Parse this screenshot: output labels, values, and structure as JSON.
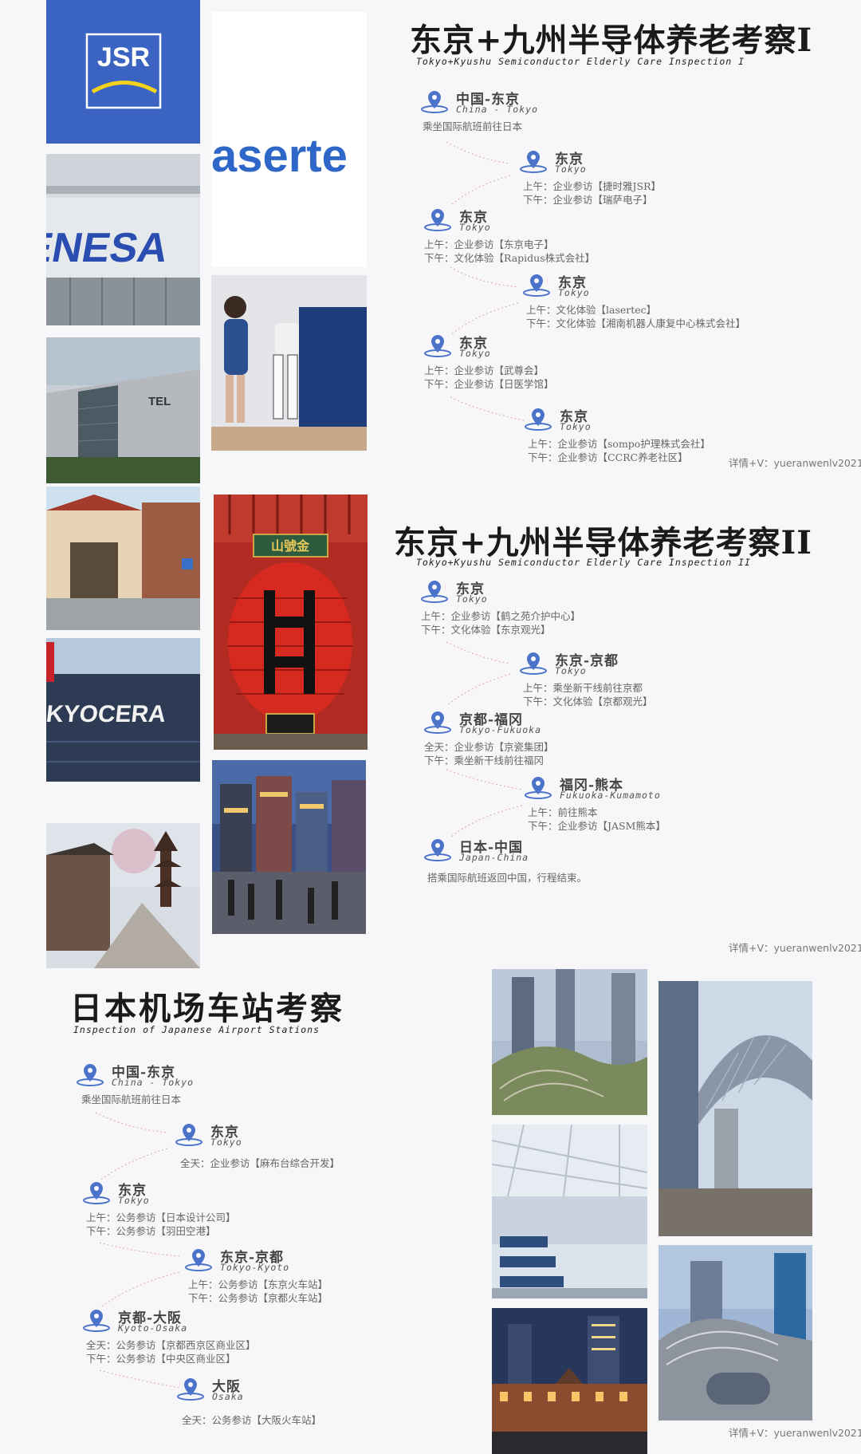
{
  "sections": [
    {
      "title": "东京+九州半导体养老考察I",
      "subtitle": "Tokyo+Kyushu Semiconductor Elderly Care Inspection I",
      "stops": [
        {
          "place": "中国-东京",
          "place_en": "China - Tokyo",
          "lines": [
            "乘坐国际航班前往日本"
          ]
        },
        {
          "place": "东京",
          "place_en": "Tokyo",
          "lines": [
            "上午：企业参访【捷时雅JSR】",
            "下午：企业参访【瑞萨电子】"
          ]
        },
        {
          "place": "东京",
          "place_en": "Tokyo",
          "lines": [
            "上午：企业参访【东京电子】",
            "下午：文化体验【Rapidus株式会社】"
          ]
        },
        {
          "place": "东京",
          "place_en": "Tokyo",
          "lines": [
            "上午：文化体验【lasertec】",
            "下午：文化体验【湘南机器人康复中心株式会社】"
          ]
        },
        {
          "place": "东京",
          "place_en": "Tokyo",
          "lines": [
            "上午：企业参访【武尊会】",
            "下午：企业参访【日医学馆】"
          ]
        },
        {
          "place": "东京",
          "place_en": "Tokyo",
          "lines": [
            "上午：企业参访【sompo护理株式会社】",
            "下午：企业参访【CCRC养老社区】"
          ]
        }
      ],
      "contact": "详情+V：yueranwenlv2021"
    },
    {
      "title": "东京+九州半导体养老考察II",
      "subtitle": "Tokyo+Kyushu Semiconductor Elderly Care Inspection II",
      "stops": [
        {
          "place": "东京",
          "place_en": "Tokyo",
          "lines": [
            "上午：企业参访【鹤之苑介护中心】",
            "下午：文化体验【东京观光】"
          ]
        },
        {
          "place": "东京-京都",
          "place_en": "Tokyo",
          "lines": [
            "上午：乘坐新干线前往京都",
            "下午：文化体验【京都观光】"
          ]
        },
        {
          "place": "京都-福冈",
          "place_en": "Tokyo-Fukuoka",
          "lines": [
            "全天：企业参访【京瓷集团】",
            "下午：乘坐新干线前往福冈"
          ]
        },
        {
          "place": "福冈-熊本",
          "place_en": "Fukuoka-Kumamoto",
          "lines": [
            "上午：前往熊本",
            "下午：企业参访【JASM熊本】"
          ]
        },
        {
          "place": "日本-中国",
          "place_en": "Japan-China",
          "lines": [
            "搭乘国际航班返回中国，行程结束。"
          ]
        }
      ],
      "contact": "详情+V：yueranwenlv2021"
    },
    {
      "title": "日本机场车站考察",
      "subtitle": "Inspection of Japanese Airport Stations",
      "stops": [
        {
          "place": "中国-东京",
          "place_en": "China - Tokyo",
          "lines": [
            "乘坐国际航班前往日本"
          ]
        },
        {
          "place": "东京",
          "place_en": "Tokyo",
          "lines": [
            "全天：企业参访【麻布台综合开发】"
          ]
        },
        {
          "place": "东京",
          "place_en": "Tokyo",
          "lines": [
            "上午：公务参访【日本设计公司】",
            "下午：公务参访【羽田空港】"
          ]
        },
        {
          "place": "东京-京都",
          "place_en": "Tokyo-Kyoto",
          "lines": [
            "上午：公务参访【东京火车站】",
            "下午：公务参访【京都火车站】"
          ]
        },
        {
          "place": "京都-大阪",
          "place_en": "Kyoto-Osaka",
          "lines": [
            "全天：公务参访【京都西京区商业区】",
            "下午：公务参访【中央区商业区】"
          ]
        },
        {
          "place": "大阪",
          "place_en": "Osaka",
          "lines": [
            "全天：公务参访【大阪火车站】"
          ]
        }
      ],
      "contact": "详情+V：yueranwenlv2021"
    }
  ],
  "photos": {
    "jsr_logo": "JSR",
    "lasertec_sign": "aserte",
    "renesas_sign": "ENESA",
    "tel_sign": "TEL",
    "kyocera_sign": "KYOCERA",
    "gate_plaque": "山號金"
  },
  "colors": {
    "pin": "#4a73c9",
    "jsr_blue": "#3a62c0",
    "lasertec_blue": "#2f67c8"
  }
}
